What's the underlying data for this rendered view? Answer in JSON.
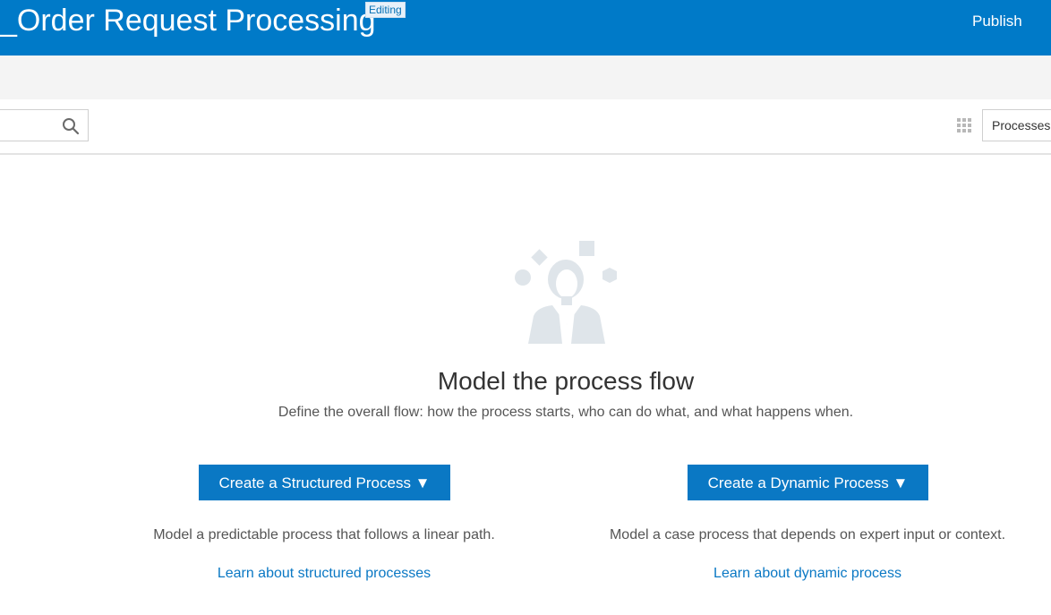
{
  "header": {
    "title": "_Order Request Processing",
    "badge": "Editing",
    "publish_label": "Publish",
    "background_color": "#007ac8"
  },
  "toolbar": {
    "search": {
      "value": "",
      "placeholder": "",
      "icon": "search-icon"
    },
    "view_icon": "grid-icon",
    "filter_select": "Processes"
  },
  "empty_state": {
    "illustration_icon": "person-with-shapes-icon",
    "title": "Model the process flow",
    "subtitle": "Define the overall flow: how the process starts, who can do what, and what happens when.",
    "structured": {
      "button_label": "Create a Structured Process ▼",
      "description": "Model a predictable process that follows a linear path.",
      "link": "Learn about structured processes"
    },
    "dynamic": {
      "button_label": "Create a Dynamic Process ▼",
      "description": "Model a case process that depends on expert input or context.",
      "link": "Learn about dynamic process"
    },
    "accent_color": "#0a78c4"
  }
}
